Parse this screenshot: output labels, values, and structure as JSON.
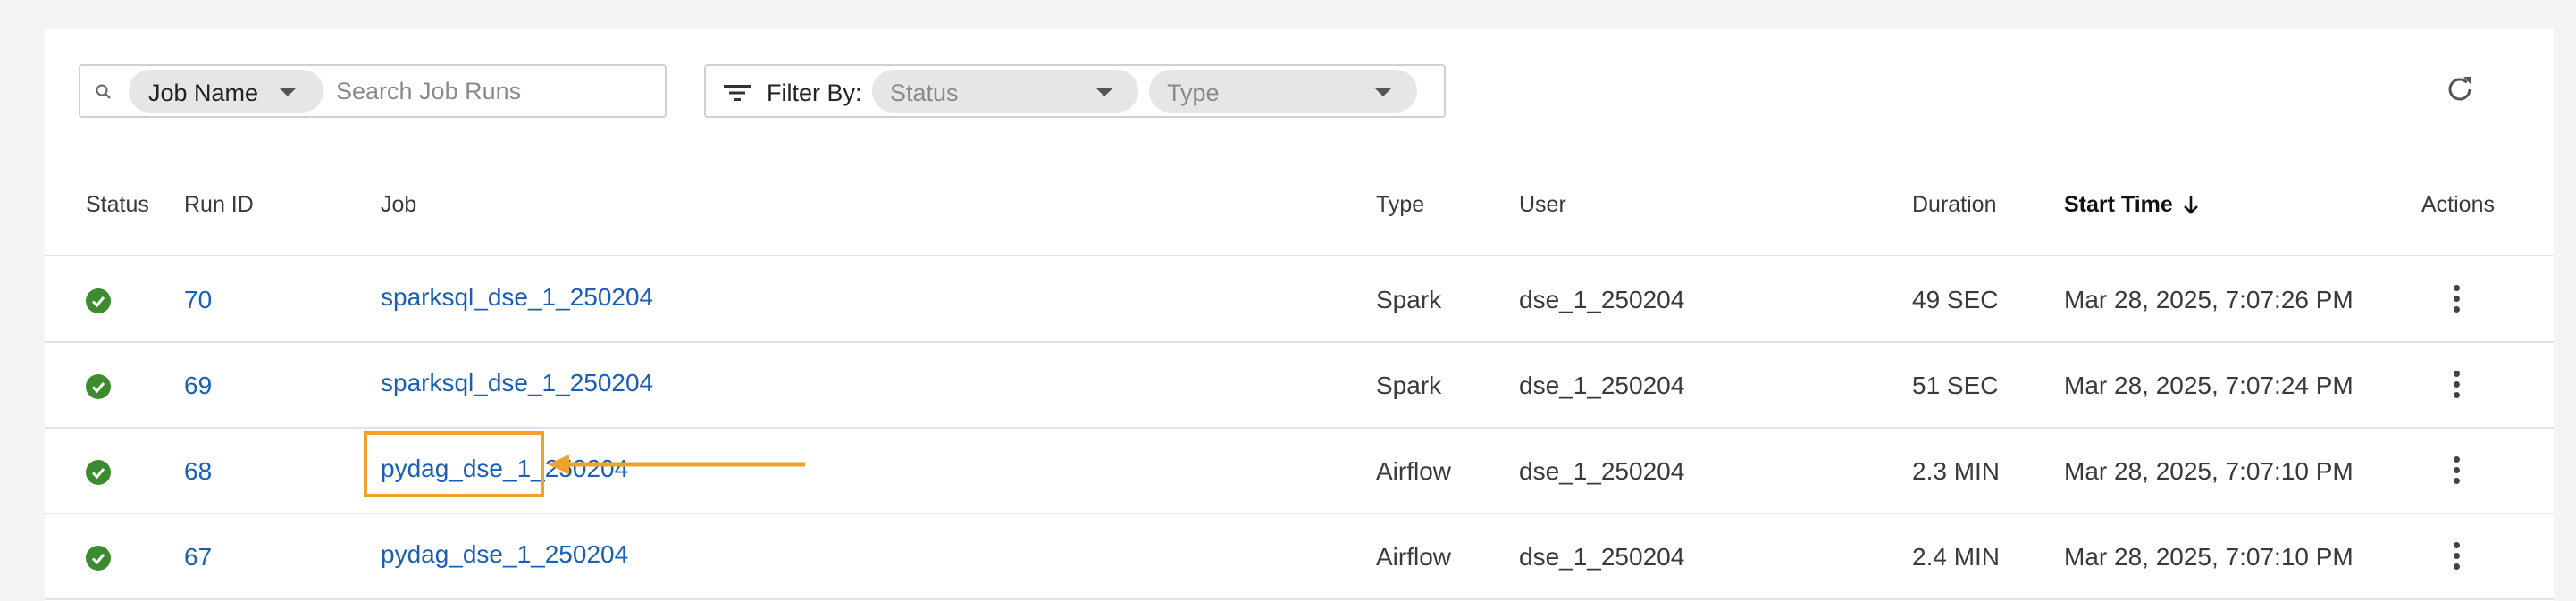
{
  "search": {
    "field_selector_label": "Job Name",
    "placeholder": "Search Job Runs",
    "value": ""
  },
  "filter": {
    "label": "Filter By:",
    "status_placeholder": "Status",
    "type_placeholder": "Type"
  },
  "table": {
    "columns": {
      "status": "Status",
      "run_id": "Run ID",
      "job": "Job",
      "type": "Type",
      "user": "User",
      "duration": "Duration",
      "start_time": "Start Time",
      "actions": "Actions"
    },
    "rows": [
      {
        "status": "success",
        "run_id": "70",
        "job": "sparksql_dse_1_250204",
        "type": "Spark",
        "user": "dse_1_250204",
        "duration": "49 SEC",
        "start_time": "Mar 28, 2025, 7:07:26 PM"
      },
      {
        "status": "success",
        "run_id": "69",
        "job": "sparksql_dse_1_250204",
        "type": "Spark",
        "user": "dse_1_250204",
        "duration": "51 SEC",
        "start_time": "Mar 28, 2025, 7:07:24 PM"
      },
      {
        "status": "success",
        "run_id": "68",
        "job": "pydag_dse_1_250204",
        "type": "Airflow",
        "user": "dse_1_250204",
        "duration": "2.3 MIN",
        "start_time": "Mar 28, 2025, 7:07:10 PM"
      },
      {
        "status": "success",
        "run_id": "67",
        "job": "pydag_dse_1_250204",
        "type": "Airflow",
        "user": "dse_1_250204",
        "duration": "2.4 MIN",
        "start_time": "Mar 28, 2025, 7:07:10 PM"
      }
    ]
  },
  "sort": {
    "column": "start_time",
    "direction": "descending"
  },
  "colors": {
    "link": "#1a5fb4",
    "success": "#3d8b2f",
    "highlight": "#f0a12a"
  }
}
